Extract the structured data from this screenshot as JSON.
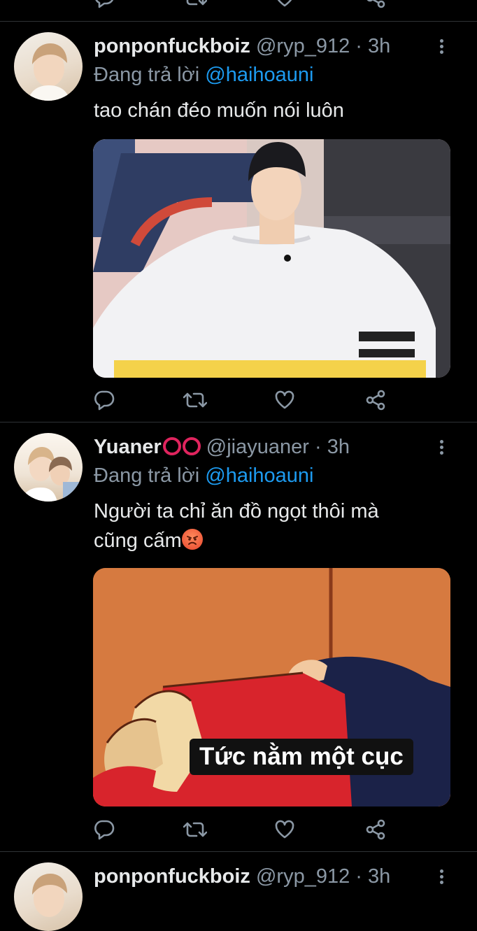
{
  "tweets": [
    {
      "name": "ponponfuckboiz",
      "handle": "@ryp_912",
      "separator": "·",
      "time": "3h",
      "reply_prefix": "Đang trả lời",
      "reply_to": "@haihoauni",
      "text": "tao chán đéo muốn nói luôn"
    },
    {
      "name": "Yuaner",
      "handle": "@jiayuaner",
      "separator": "·",
      "time": "3h",
      "reply_prefix": "Đang trả lời",
      "reply_to": "@haihoauni",
      "text_line1": "Người ta chỉ ăn đồ ngọt thôi mà",
      "text_line2": "cũng cấm",
      "caption": "Tức nằm một cục"
    },
    {
      "name": "ponponfuckboiz",
      "handle": "@ryp_912",
      "separator": "·",
      "time": "3h"
    }
  ],
  "icons": [
    "reply-icon",
    "retweet-icon",
    "like-icon",
    "share-icon",
    "more-icon"
  ],
  "colors": {
    "background": "#000000",
    "text": "#e7e9ea",
    "muted": "#8b98a5",
    "link": "#1d9bf0"
  }
}
